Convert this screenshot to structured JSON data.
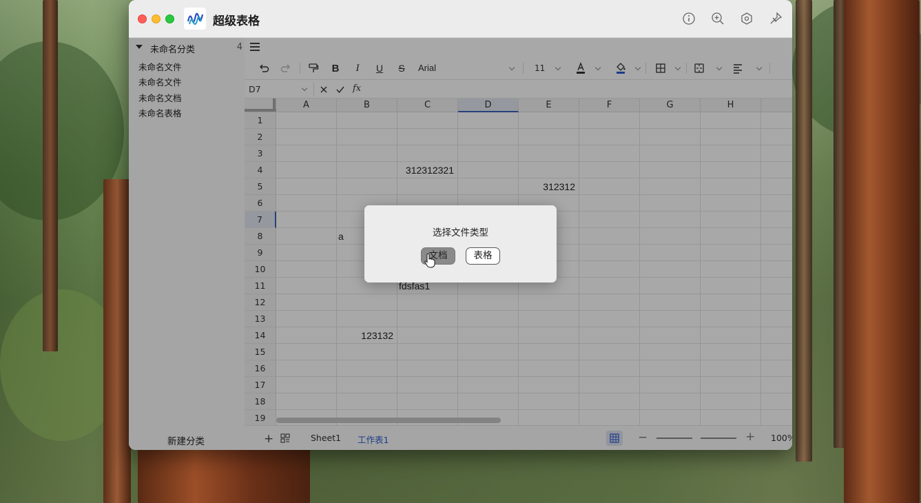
{
  "window": {
    "title": "超级表格"
  },
  "sidebar": {
    "category": {
      "name": "未命名分类",
      "count": "4"
    },
    "items": [
      {
        "label": "未命名文件"
      },
      {
        "label": "未命名文件"
      },
      {
        "label": "未命名文档"
      },
      {
        "label": "未命名表格"
      }
    ],
    "new_category_label": "新建分类"
  },
  "toolbar": {
    "font_name": "Arial",
    "font_size": "11",
    "text_color": "#333333",
    "fill_color": "#2d5bd0"
  },
  "formula_bar": {
    "cell_ref": "D7",
    "fx_label": "fx",
    "value": ""
  },
  "grid": {
    "columns": [
      "A",
      "B",
      "C",
      "D",
      "E",
      "F",
      "G",
      "H"
    ],
    "selected_column": "D",
    "rows": [
      "1",
      "2",
      "3",
      "4",
      "5",
      "6",
      "7",
      "8",
      "9",
      "10",
      "11",
      "12",
      "13",
      "14",
      "15",
      "16",
      "17",
      "18",
      "19"
    ],
    "selected_row": "7",
    "cells": {
      "C4": "312312321",
      "E5": "312312",
      "B8": "a",
      "C11": "fdsfas1",
      "B14": "123132"
    }
  },
  "sheets": {
    "tabs": [
      "Sheet1",
      "工作表1"
    ],
    "active": "工作表1"
  },
  "zoom": {
    "level": "100%"
  },
  "dialog": {
    "title": "选择文件类型",
    "buttons": {
      "doc": "文档",
      "sheet": "表格"
    }
  }
}
